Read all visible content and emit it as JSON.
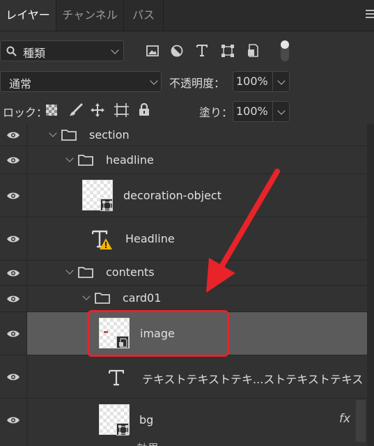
{
  "tabs": [
    {
      "label": "レイヤー",
      "active": true
    },
    {
      "label": "チャンネル",
      "active": false
    },
    {
      "label": "パス",
      "active": false
    }
  ],
  "filter": {
    "icon": "search-icon",
    "value": "種類",
    "tools": [
      "image-filter-icon",
      "adjustment-filter-icon",
      "type-filter-icon",
      "shape-filter-icon",
      "smart-object-filter-icon"
    ]
  },
  "blend": {
    "mode": "通常",
    "opacity_label": "不透明度：",
    "opacity_value": "100%"
  },
  "lock": {
    "label": "ロック：",
    "fill_label": "塗り：",
    "fill_value": "100%",
    "icons": [
      "lock-transparent-icon",
      "lock-paint-icon",
      "lock-position-icon",
      "lock-artboard-icon",
      "lock-all-icon"
    ]
  },
  "layers": [
    {
      "name": "section",
      "kind": "group"
    },
    {
      "name": "headline",
      "kind": "group"
    },
    {
      "name": "decoration-object",
      "kind": "smart-shape"
    },
    {
      "name": "Headline",
      "kind": "text-warning"
    },
    {
      "name": "contents",
      "kind": "group"
    },
    {
      "name": "card01",
      "kind": "group"
    },
    {
      "name": "image",
      "kind": "smart-object",
      "selected": true
    },
    {
      "name": "テキストテキストテキ...ストテキストテキス",
      "kind": "text"
    },
    {
      "name": "bg",
      "kind": "shape",
      "fx": "fx"
    },
    {
      "name": "効果",
      "kind": "effect"
    }
  ],
  "colors": {
    "selected_row": "#5b5b5b",
    "annotation": "#e8232a",
    "warning": "#f4b400"
  }
}
